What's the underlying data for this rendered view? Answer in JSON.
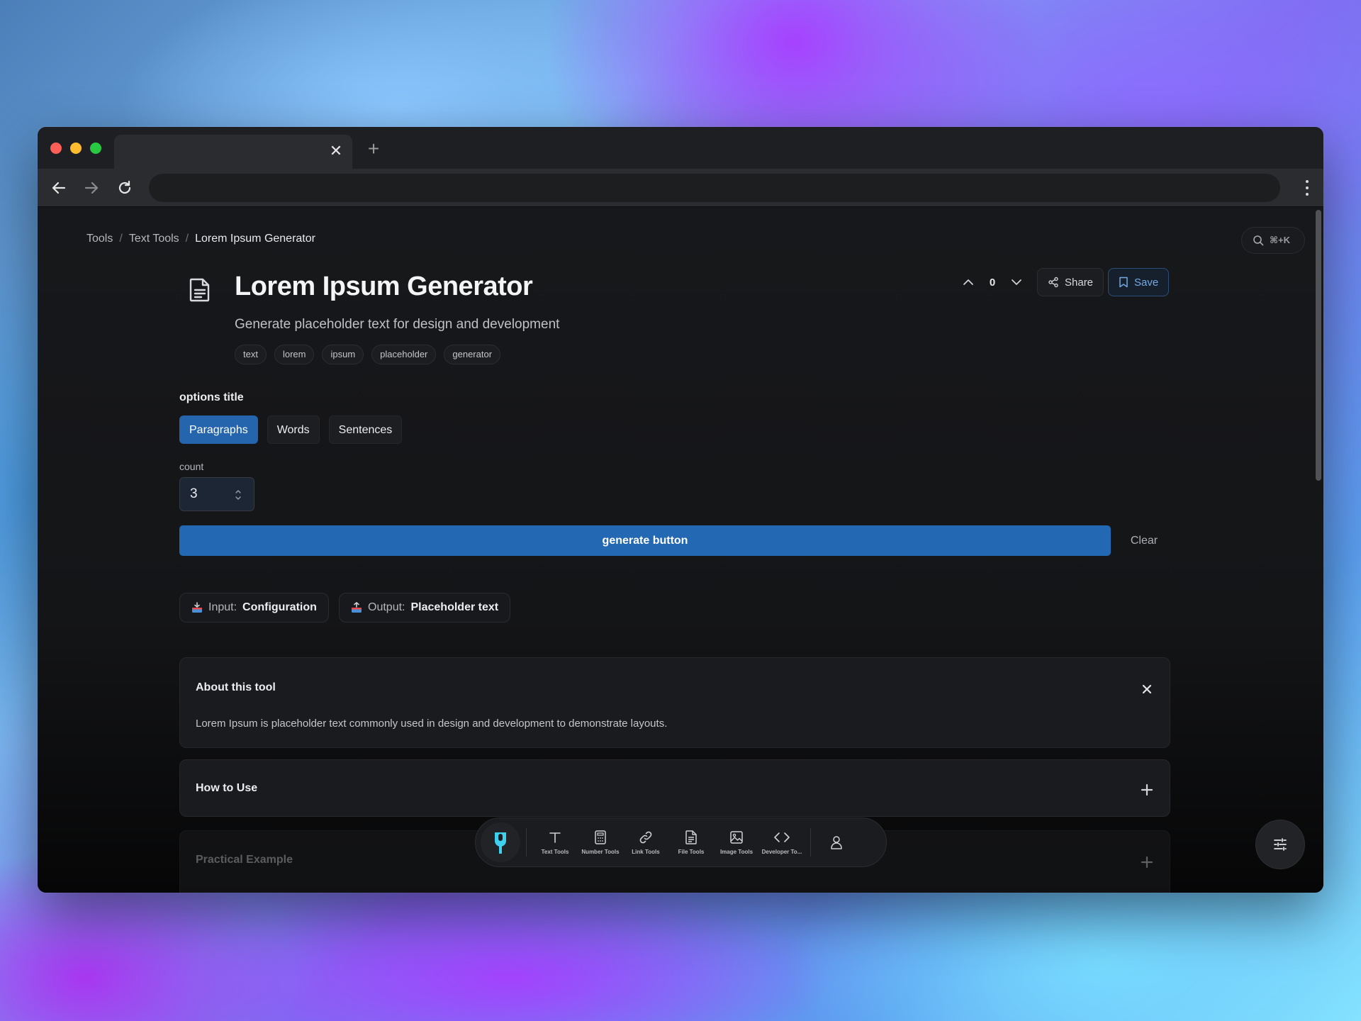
{
  "browser": {
    "tab_title": "",
    "tab_close": "✕",
    "new_tab": "+",
    "address": ""
  },
  "breadcrumb": {
    "items": [
      "Tools",
      "Text Tools"
    ],
    "separator": "/",
    "current": "Lorem Ipsum Generator"
  },
  "search": {
    "shortcut": "⌘+K",
    "icon": "search-icon"
  },
  "tool": {
    "title": "Lorem Ipsum Generator",
    "subtitle": "Generate placeholder text for design and development",
    "icon": "document-icon",
    "tags": [
      "text",
      "lorem",
      "ipsum",
      "placeholder",
      "generator"
    ]
  },
  "actions": {
    "vote_count": "0",
    "share_label": "Share",
    "save_label": "Save"
  },
  "options": {
    "title": "options title",
    "modes": [
      "Paragraphs",
      "Words",
      "Sentences"
    ],
    "selected_mode": "Paragraphs",
    "count_label": "count",
    "count_value": "3"
  },
  "buttons": {
    "generate": "generate button",
    "clear": "Clear"
  },
  "io": {
    "input_label": "Input:",
    "input_value": "Configuration",
    "output_label": "Output:",
    "output_value": "Placeholder text"
  },
  "sections": {
    "about_title": "About this tool",
    "about_body": "Lorem Ipsum is placeholder text commonly used in design and development to demonstrate layouts.",
    "how_title": "How to Use",
    "example_title": "Practical Example"
  },
  "dock": {
    "items": [
      "Text Tools",
      "Number Tools",
      "Link Tools",
      "File Tools",
      "Image Tools",
      "Developer To..."
    ]
  },
  "colors": {
    "accent": "#2368b2",
    "save_accent": "#74a8e4",
    "logo_accent": "#3fd0f0"
  }
}
